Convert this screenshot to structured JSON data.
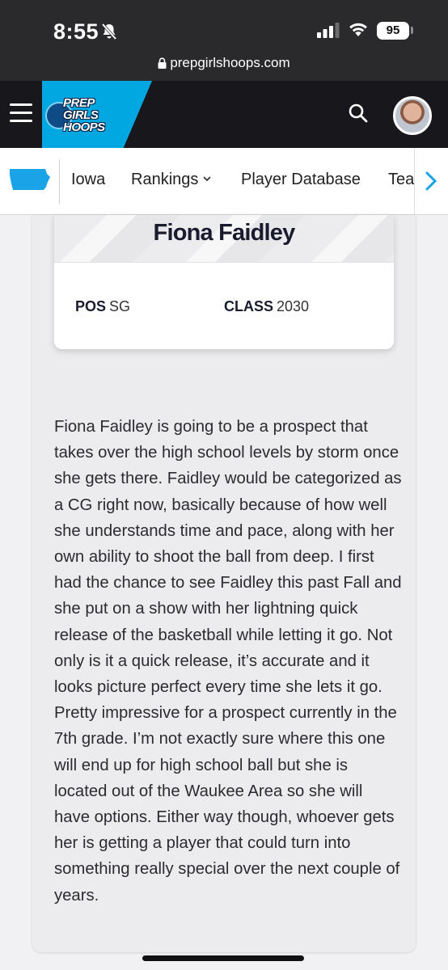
{
  "status_bar": {
    "time": "8:55",
    "battery": "95",
    "icons": [
      "bell-slash-icon",
      "signal-icon",
      "wifi-icon",
      "battery-icon"
    ]
  },
  "browser": {
    "url": "prepgirlshoops.com"
  },
  "header": {
    "logo_text": "PREP GIRLS HOOPS",
    "icons": [
      "menu-icon",
      "search-icon"
    ],
    "accent_color": "#00a7e1"
  },
  "sub_nav": {
    "state_icon": "iowa-state-icon",
    "items": [
      {
        "label": "Iowa"
      },
      {
        "label": "Rankings"
      },
      {
        "label": "Player Database"
      },
      {
        "label": "Tea"
      }
    ]
  },
  "player": {
    "name": "Fiona Faidley",
    "pos_label": "POS",
    "pos_value": "SG",
    "class_label": "CLASS",
    "class_value": "2030"
  },
  "article": {
    "body": "Fiona Faidley is going to be a prospect that takes over the high school levels by storm once she gets there. Faidley would be categorized as a CG right now, basically because of how well she understands time and pace, along with her own ability to shoot the ball from deep. I first had the chance to see Faidley this past Fall and she put on a show with her lightning quick release of the basketball while letting it go. Not only is it a quick release, it’s accurate and it looks picture perfect every time she lets it go. Pretty impressive for a prospect currently in the 7th grade. I’m not exactly sure where this one will end up for high school ball but she is located out of the Waukee Area so she will have options. Either way though, whoever gets her is getting a player that could turn into something really special over the next couple of years."
  }
}
